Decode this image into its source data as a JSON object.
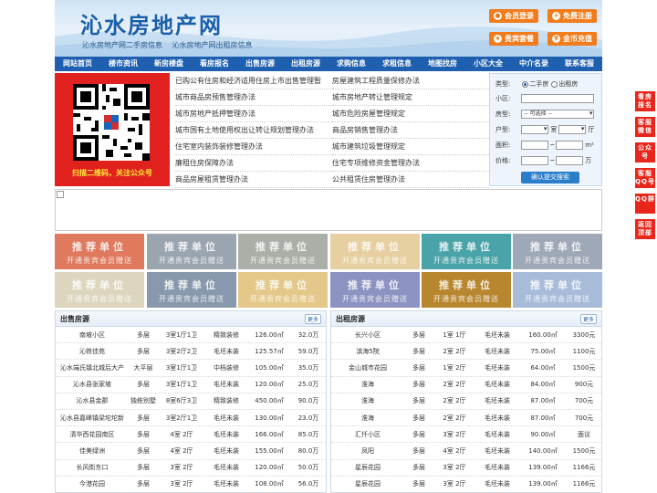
{
  "header": {
    "site_title": "沁水房地产网",
    "sub_links": [
      "沁水房地产网二手房信息",
      "沁水房地产网出租房信息"
    ],
    "buttons": [
      {
        "label": "会员登录",
        "icon": "user-icon"
      },
      {
        "label": "免费注册",
        "icon": "register-icon"
      },
      {
        "label": "贵宾套餐",
        "icon": "vip-icon"
      },
      {
        "label": "金币充值",
        "icon": "coin-icon"
      }
    ]
  },
  "nav": [
    "网站首页",
    "楼市资讯",
    "新房楼盘",
    "看房报名",
    "出售房源",
    "出租房源",
    "求购信息",
    "求租信息",
    "地图找房",
    "小区大全",
    "中介名录",
    "联系客服"
  ],
  "qr": {
    "caption": "扫描二维码，关注公众号"
  },
  "policies_left": [
    "已购公有住房和经济适用住房上市出售管理暂",
    "城市商品房预售管理办法",
    "城市房地产抵押管理办法",
    "城市国有土地使用权出让转让规划管理办法",
    "住宅室内装饰装修管理办法",
    "廉租住房保障办法",
    "商品房屋租赁管理办法"
  ],
  "policies_right": [
    "房屋建筑工程质量保修办法",
    "城市房地产转让管理规定",
    "城市危险房屋管理规定",
    "商品房销售管理办法",
    "城市建筑垃圾管理规定",
    "住宅专项维修资金管理办法",
    "公共租赁住房管理办法"
  ],
  "search": {
    "type_label": "类型:",
    "type_options": [
      "二手房",
      "出租房"
    ],
    "community_label": "小区:",
    "house_type_label": "房型:",
    "house_type_value": "-- 可选择 --",
    "layout_label": "户型:",
    "room_unit": "室",
    "hall_unit": "厅",
    "area_label": "面积:",
    "area_unit": "m²",
    "price_label": "价格:",
    "price_unit": "万",
    "range_sep": "~",
    "submit_label": "确认提交搜索"
  },
  "recommend": {
    "line1": "推荐单位",
    "line2": "开通贵宾会员赠送",
    "colors": [
      "#e07a5f",
      "#9aa5b0",
      "#aab0a8",
      "#e6cfa0",
      "#4aa3a8",
      "#9fa8b6",
      "#ddd6bf",
      "#8899ad",
      "#e3c88a",
      "#8c93c2",
      "#b8862e",
      "#a8bcd9"
    ]
  },
  "sale_panel": {
    "title": "出售房源",
    "more": "更多",
    "rows": [
      [
        "南坡小区",
        "多层",
        "3室1厅1卫",
        "精致装修",
        "126.00㎡",
        "32.0万"
      ],
      [
        "沁铁佳苑",
        "多层",
        "3室2厅2卫",
        "毛坯未装",
        "125.57㎡",
        "59.0万"
      ],
      [
        "沁水端氏镇北城后大产",
        "大平层",
        "3室1厅1卫",
        "中档装修",
        "105.00㎡",
        "35.0万"
      ],
      [
        "沁水县张家坡",
        "多层",
        "3室1厅1卫",
        "毛坯未装",
        "120.00㎡",
        "25.0万"
      ],
      [
        "沁水县金郡",
        "独栋别墅",
        "8室6厅3卫",
        "精致装修",
        "450.00㎡",
        "90.0万"
      ],
      [
        "沁水县嘉峰镇梁坨坨新",
        "多层",
        "3室2厅1卫",
        "毛坯未装",
        "130.00㎡",
        "23.0万"
      ],
      [
        "清华西花园南区",
        "多层",
        "4室 2厅",
        "毛坯未装",
        "166.00㎡",
        "85.0万"
      ],
      [
        "佳美绿洲",
        "多层",
        "4室 2厅",
        "毛坯未装",
        "155.00㎡",
        "80.0万"
      ],
      [
        "长风街东口",
        "多层",
        "3室 2厅",
        "毛坯未装",
        "120.00㎡",
        "50.0万"
      ],
      [
        "今港花园",
        "多层",
        "3室 2厅",
        "毛坯未装",
        "108.00㎡",
        "56.0万"
      ]
    ]
  },
  "rent_panel": {
    "title": "出租房源",
    "more": "更多",
    "rows": [
      [
        "长兴小区",
        "多层",
        "1室 1厅",
        "毛坯未装",
        "160.00㎡",
        "3300元"
      ],
      [
        "滨海5院",
        "多层",
        "2室 2厅",
        "毛坯未装",
        "75.00㎡",
        "1100元"
      ],
      [
        "金山城市花园",
        "多层",
        "1室 2厅",
        "毛坯未装",
        "64.00㎡",
        "1500元"
      ],
      [
        "淮海",
        "多层",
        "2室 2厅",
        "毛坯未装",
        "84.00㎡",
        "900元"
      ],
      [
        "淮海",
        "多层",
        "2室 2厅",
        "毛坯未装",
        "87.00㎡",
        "700元"
      ],
      [
        "淮海",
        "多层",
        "2室 2厅",
        "毛坯未装",
        "87.00㎡",
        "700元"
      ],
      [
        "汇仟小区",
        "多层",
        "3室 2厅",
        "毛坯未装",
        "90.00㎡",
        "面议"
      ],
      [
        "凤阳",
        "多层",
        "4室 2厅",
        "毛坯未装",
        "140.00㎡",
        "1500元"
      ],
      [
        "星辰花园",
        "多层",
        "3室 2厅",
        "毛坯未装",
        "139.00㎡",
        "1166元"
      ],
      [
        "星辰花园",
        "多层",
        "3室 2厅",
        "毛坯未装",
        "139.00㎡",
        "1166元"
      ]
    ]
  },
  "side_buttons": [
    "看房报名",
    "客服微信",
    "公众号",
    "客服QQ号",
    "QQ群",
    "返回顶部"
  ]
}
